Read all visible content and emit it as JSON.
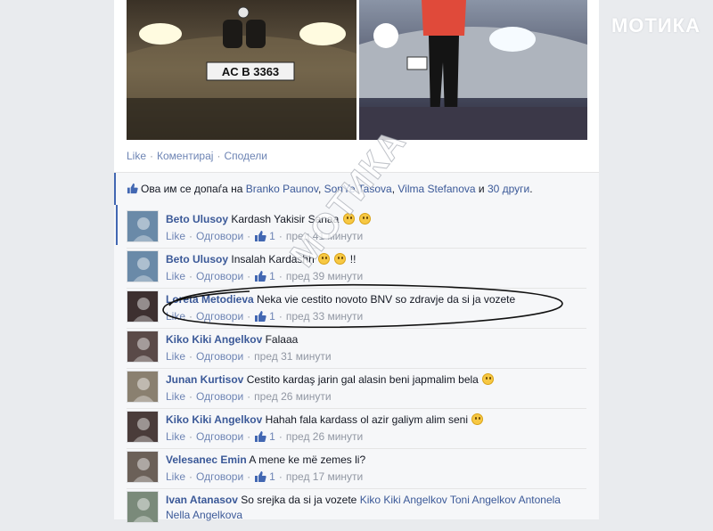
{
  "watermark": "МОТИКА",
  "photo_plate": "AC B 3363",
  "post_actions": {
    "like": "Like",
    "comment": "Коментирај",
    "share": "Сподели",
    "separator": "·"
  },
  "likes_summary": {
    "prefix": "Ова им се допаѓа на",
    "names": [
      "Branko Paunov",
      "SonYe Tasova",
      "Vilma Stefanova"
    ],
    "comma": ",",
    "conjunction": "и",
    "others": "30 други",
    "period": "."
  },
  "comments": [
    {
      "author": "Beto Ulusoy",
      "text": "Kardash Yakisir Sanaa",
      "emojis": 2,
      "like": "Like",
      "reply": "Одговори",
      "likes": "1",
      "time": "пред 41 минути"
    },
    {
      "author": "Beto Ulusoy",
      "text": "Insalah Kardashh",
      "emojis": 2,
      "suffix": "!!",
      "like": "Like",
      "reply": "Одговори",
      "likes": "1",
      "time": "пред 39 минути"
    },
    {
      "author": "Loreta Metodieva",
      "text": "Neka vie cestito novoto BNV so zdravje da si ja vozete",
      "emojis": 0,
      "like": "Like",
      "reply": "Одговори",
      "likes": "1",
      "time": "пред 33 минути"
    },
    {
      "author": "Kiko Kiki Angelkov",
      "text": "Falaaa",
      "emojis": 0,
      "like": "Like",
      "reply": "Одговори",
      "likes": "",
      "time": "пред 31 минути"
    },
    {
      "author": "Junan Kurtisov",
      "text": "Cestito kardaş jarin gal alasin beni japmalim bela",
      "emojis": 1,
      "like": "Like",
      "reply": "Одговори",
      "likes": "",
      "time": "пред 26 минути"
    },
    {
      "author": "Kiko Kiki Angelkov",
      "text": "Hahah fala kardass ol azir galiym alim seni",
      "emojis": 1,
      "like": "Like",
      "reply": "Одговори",
      "likes": "1",
      "time": "пред 26 минути"
    },
    {
      "author": "Velesanec Emin",
      "text": "A mene ke më zemes li?",
      "emojis": 0,
      "like": "Like",
      "reply": "Одговори",
      "likes": "1",
      "time": "пред 17 минути"
    },
    {
      "author": "Ivan Atanasov",
      "text": "So srejka da si ja vozete",
      "mentions": [
        "Kiko Kiki Angelkov",
        "Toni Angelkov",
        "Antonela Nella Angelkova"
      ],
      "emojis": 0
    }
  ],
  "colors": {
    "link": "#3b5998",
    "meta": "#9197a3",
    "accent": "#4267b2"
  }
}
